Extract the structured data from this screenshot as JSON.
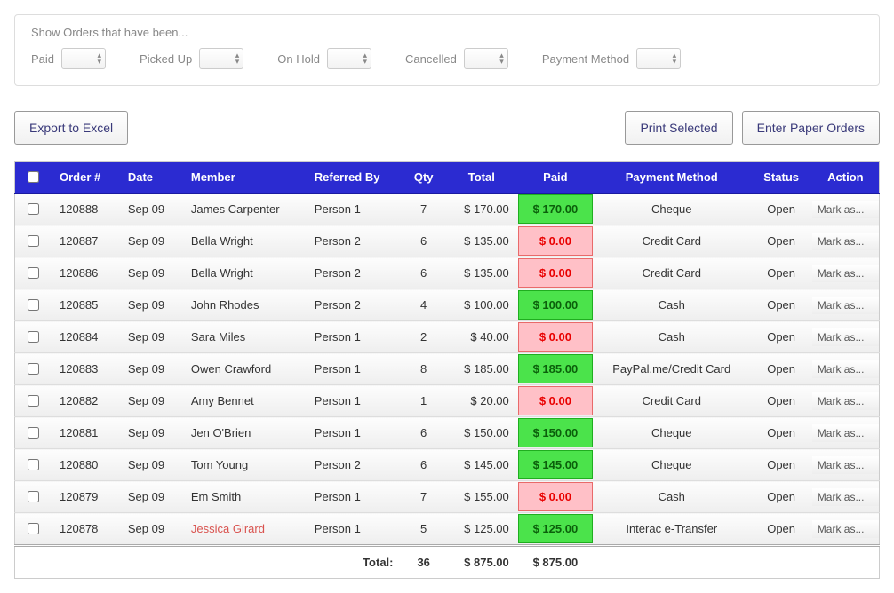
{
  "filters": {
    "title": "Show Orders that have been...",
    "paid_label": "Paid",
    "picked_up_label": "Picked Up",
    "on_hold_label": "On Hold",
    "cancelled_label": "Cancelled",
    "payment_method_label": "Payment Method"
  },
  "buttons": {
    "export": "Export to Excel",
    "print_selected": "Print Selected",
    "enter_paper": "Enter Paper Orders"
  },
  "table": {
    "headers": {
      "order": "Order #",
      "date": "Date",
      "member": "Member",
      "referred_by": "Referred By",
      "qty": "Qty",
      "total": "Total",
      "paid": "Paid",
      "payment_method": "Payment Method",
      "status": "Status",
      "action": "Action"
    },
    "action_label": "Mark as...",
    "totals": {
      "label": "Total:",
      "qty": "36",
      "total": "$ 875.00",
      "paid": "$ 875.00"
    },
    "rows": [
      {
        "order": "120888",
        "date": "Sep 09",
        "member": "James Carpenter",
        "member_link": false,
        "referred_by": "Person 1",
        "qty": "7",
        "total": "$ 170.00",
        "paid": "$ 170.00",
        "paid_state": "green",
        "payment_method": "Cheque",
        "status": "Open"
      },
      {
        "order": "120887",
        "date": "Sep 09",
        "member": "Bella Wright",
        "member_link": false,
        "referred_by": "Person 2",
        "qty": "6",
        "total": "$ 135.00",
        "paid": "$ 0.00",
        "paid_state": "red",
        "payment_method": "Credit Card",
        "status": "Open"
      },
      {
        "order": "120886",
        "date": "Sep 09",
        "member": "Bella Wright",
        "member_link": false,
        "referred_by": "Person 2",
        "qty": "6",
        "total": "$ 135.00",
        "paid": "$ 0.00",
        "paid_state": "red",
        "payment_method": "Credit Card",
        "status": "Open"
      },
      {
        "order": "120885",
        "date": "Sep 09",
        "member": "John Rhodes",
        "member_link": false,
        "referred_by": "Person 2",
        "qty": "4",
        "total": "$ 100.00",
        "paid": "$ 100.00",
        "paid_state": "green",
        "payment_method": "Cash",
        "status": "Open"
      },
      {
        "order": "120884",
        "date": "Sep 09",
        "member": "Sara Miles",
        "member_link": false,
        "referred_by": "Person 1",
        "qty": "2",
        "total": "$ 40.00",
        "paid": "$ 0.00",
        "paid_state": "red",
        "payment_method": "Cash",
        "status": "Open"
      },
      {
        "order": "120883",
        "date": "Sep 09",
        "member": "Owen Crawford",
        "member_link": false,
        "referred_by": "Person 1",
        "qty": "8",
        "total": "$ 185.00",
        "paid": "$ 185.00",
        "paid_state": "green",
        "payment_method": "PayPal.me/Credit Card",
        "status": "Open"
      },
      {
        "order": "120882",
        "date": "Sep 09",
        "member": "Amy Bennet",
        "member_link": false,
        "referred_by": "Person 1",
        "qty": "1",
        "total": "$ 20.00",
        "paid": "$ 0.00",
        "paid_state": "red",
        "payment_method": "Credit Card",
        "status": "Open"
      },
      {
        "order": "120881",
        "date": "Sep 09",
        "member": "Jen O'Brien",
        "member_link": false,
        "referred_by": "Person 1",
        "qty": "6",
        "total": "$ 150.00",
        "paid": "$ 150.00",
        "paid_state": "green",
        "payment_method": "Cheque",
        "status": "Open"
      },
      {
        "order": "120880",
        "date": "Sep 09",
        "member": "Tom Young",
        "member_link": false,
        "referred_by": "Person 2",
        "qty": "6",
        "total": "$ 145.00",
        "paid": "$ 145.00",
        "paid_state": "green",
        "payment_method": "Cheque",
        "status": "Open"
      },
      {
        "order": "120879",
        "date": "Sep 09",
        "member": "Em Smith",
        "member_link": false,
        "referred_by": "Person 1",
        "qty": "7",
        "total": "$ 155.00",
        "paid": "$ 0.00",
        "paid_state": "red",
        "payment_method": "Cash",
        "status": "Open"
      },
      {
        "order": "120878",
        "date": "Sep 09",
        "member": "Jessica Girard",
        "member_link": true,
        "referred_by": "Person 1",
        "qty": "5",
        "total": "$ 125.00",
        "paid": "$ 125.00",
        "paid_state": "green",
        "payment_method": "Interac e-Transfer",
        "status": "Open"
      }
    ]
  }
}
